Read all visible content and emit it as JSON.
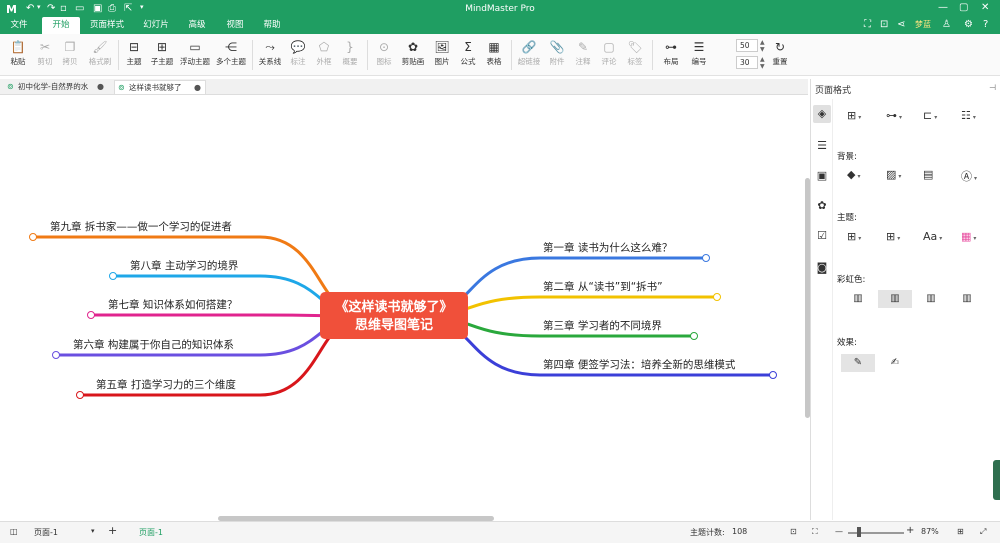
{
  "app": {
    "title": "MindMaster Pro",
    "user": "梦蓝",
    "menu_tabs": [
      "文件",
      "开始",
      "页面样式",
      "幻灯片",
      "高级",
      "视图",
      "帮助"
    ]
  },
  "ribbon": {
    "buttons": [
      {
        "label": "粘贴",
        "icon": "clipboard-icon"
      },
      {
        "label": "剪切",
        "icon": "scissors-icon"
      },
      {
        "label": "拷贝",
        "icon": "copy-icon"
      },
      {
        "label": "格式刷",
        "icon": "format-brush-icon"
      },
      {
        "label": "主题",
        "icon": "topic-icon"
      },
      {
        "label": "子主题",
        "icon": "subtopic-icon"
      },
      {
        "label": "浮动主题",
        "icon": "floating-topic-icon"
      },
      {
        "label": "多个主题",
        "icon": "multi-topic-icon"
      },
      {
        "label": "关系线",
        "icon": "relation-icon"
      },
      {
        "label": "标注",
        "icon": "callout-icon"
      },
      {
        "label": "外框",
        "icon": "boundary-icon"
      },
      {
        "label": "概要",
        "icon": "summary-icon"
      },
      {
        "label": "图标",
        "icon": "mark-icon"
      },
      {
        "label": "剪贴画",
        "icon": "clipart-icon"
      },
      {
        "label": "图片",
        "icon": "image-icon"
      },
      {
        "label": "公式",
        "icon": "formula-icon"
      },
      {
        "label": "表格",
        "icon": "table-icon"
      },
      {
        "label": "超链接",
        "icon": "link-icon"
      },
      {
        "label": "附件",
        "icon": "attachment-icon"
      },
      {
        "label": "注释",
        "icon": "note-icon"
      },
      {
        "label": "评论",
        "icon": "comment-icon"
      },
      {
        "label": "标签",
        "icon": "tag-icon"
      },
      {
        "label": "布局",
        "icon": "layout-icon"
      },
      {
        "label": "编号",
        "icon": "numbering-icon"
      },
      {
        "label": "重置",
        "icon": "reset-icon"
      }
    ],
    "spin1": "50",
    "spin2": "30"
  },
  "doc_tabs": [
    {
      "label": "初中化学-自然界的水"
    },
    {
      "label": "这样读书就够了"
    }
  ],
  "mindmap": {
    "central": [
      "《这样读书就够了》",
      "思维导图笔记"
    ],
    "right": [
      {
        "text": "第一章  读书为什么这么难？",
        "color": "#3a78e0"
      },
      {
        "text": "第二章  从“读书”到“拆书”",
        "color": "#f2c200"
      },
      {
        "text": "第三章  学习者的不同境界",
        "color": "#2aa83c"
      },
      {
        "text": "第四章  便签学习法：培养全新的思维模式",
        "color": "#3b3fd8"
      }
    ],
    "left": [
      {
        "text": "第九章  拆书家——做一个学习的促进者",
        "color": "#f07a14"
      },
      {
        "text": "第八章  主动学习的境界",
        "color": "#1ea7e8"
      },
      {
        "text": "第七章  知识体系如何搭建？",
        "color": "#e0248e"
      },
      {
        "text": "第六章  构建属于你自己的知识体系",
        "color": "#6a4fe0"
      },
      {
        "text": "第五章  打造学习力的三个维度",
        "color": "#d8161b"
      }
    ]
  },
  "panel": {
    "title": "页面格式",
    "background_label": "背景:",
    "theme_label": "主题:",
    "rainbow_label": "彩虹色:",
    "effect_label": "效果:"
  },
  "status": {
    "page_select": "页面-1",
    "page_tab": "页面-1",
    "topic_count_label": "主题计数:",
    "topic_count": "108",
    "zoom": "87%"
  }
}
